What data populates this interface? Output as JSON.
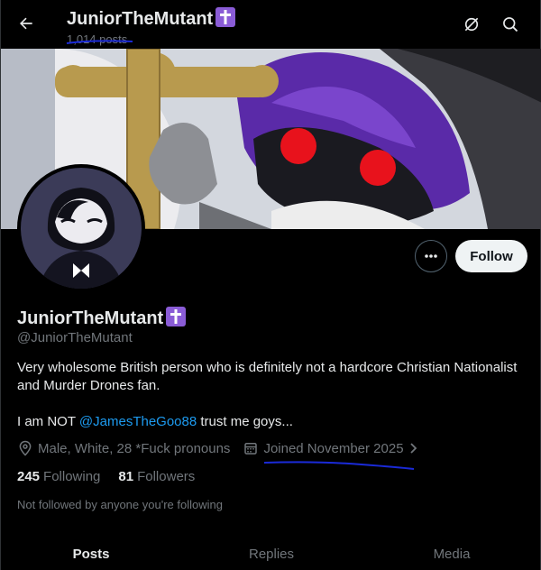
{
  "header": {
    "title": "JuniorTheMutant",
    "post_count": "1,014 posts"
  },
  "profile": {
    "display_name": "JuniorTheMutant",
    "handle": "@JuniorTheMutant",
    "bio_line1": "Very wholesome British person who is definitely not a hardcore Christian Nationalist and Murder Drones fan.",
    "bio_line2_prefix": "I am NOT ",
    "bio_mention": "@JamesTheGoo88",
    "bio_line2_suffix": " trust me goys...",
    "location": "Male, White, 28 *Fuck pronouns",
    "joined": "Joined November 2025"
  },
  "stats": {
    "following_count": "245",
    "following_label": "Following",
    "followers_count": "81",
    "followers_label": "Followers"
  },
  "not_followed": "Not followed by anyone you're following",
  "actions": {
    "follow_label": "Follow"
  },
  "tabs": [
    {
      "label": "Posts",
      "active": true
    },
    {
      "label": "Replies",
      "active": false
    },
    {
      "label": "Media",
      "active": false
    }
  ],
  "colors": {
    "accent": "#1d9bf0",
    "badge": "#8a5cd6",
    "annotation": "#1a2ad8"
  },
  "icons": [
    "back-arrow-icon",
    "cross-badge-icon",
    "grok-icon",
    "search-icon",
    "more-icon",
    "location-icon",
    "calendar-icon",
    "chevron-right-icon"
  ]
}
